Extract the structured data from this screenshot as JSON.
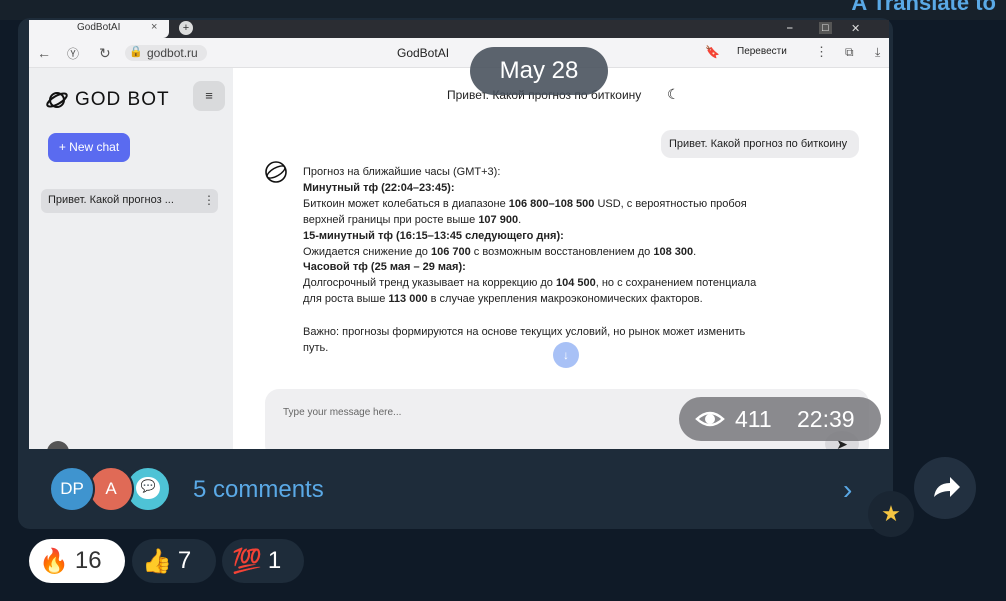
{
  "top": {
    "translate_label": "A Translate to"
  },
  "browser": {
    "tab_title": "GodBotAI",
    "tab_close": "×",
    "tab_plus": "+",
    "url": "godbot.ru",
    "page_title": "GodBotAI",
    "translate_label": "Перевести",
    "window_controls": [
      "⎯",
      "□",
      "✕"
    ]
  },
  "app": {
    "logo_text": "GOD BOT",
    "menu_icon": "≡",
    "new_chat_label": "+ New chat",
    "history": [
      {
        "label": "Привет. Какой прогноз ..."
      }
    ],
    "chat_title": "Привет. Какой прогноз по биткоину",
    "user_message": "Привет. Какой прогноз по биткоину",
    "bot_message": {
      "line1": "Прогноз на ближайшие часы (GMT+3):",
      "h1": "Минутный тф (22:04–23:45):",
      "p1a": "Биткоин может колебаться в диапазоне ",
      "p1b": "106 800–108 500",
      "p1c": " USD, с вероятностью пробоя",
      "p1d": "верхней границы при росте выше ",
      "p1e": "107 900",
      "p1f": ".",
      "h2": "15-минутный тф (16:15–13:45 следующего дня):",
      "p2a": "Ожидается снижение до ",
      "p2b": "106 700",
      "p2c": " с возможным восстановлением до ",
      "p2d": "108 300",
      "p2e": ".",
      "h3": "Часовой тф (25 мая – 29 мая):",
      "p3a": "Долгосрочный тренд указывает на коррекцию до ",
      "p3b": "104 500",
      "p3c": ", но с сохранением потенциала",
      "p3d": "для роста выше ",
      "p3e": "113 000",
      "p3f": " в случае укрепления макроэкономических факторов.",
      "p4a": "Важно: прогнозы формируются на основе текущих условий, но рынок может изменить",
      "p4b": "путь."
    },
    "input_placeholder": "Type your message here..."
  },
  "post": {
    "date": "May 28",
    "views": "411",
    "time": "22:39",
    "comments_label": "5 comments",
    "commenters": [
      "DP",
      "A"
    ]
  },
  "reactions": [
    {
      "emoji": "🔥",
      "count": "16"
    },
    {
      "emoji": "👍",
      "count": "7"
    },
    {
      "emoji": "💯",
      "count": "1"
    }
  ],
  "icons": {
    "star": "★",
    "chevron": "›",
    "scroll_down": "↓",
    "send": "➤",
    "moon": "☾",
    "bubble": "💬"
  }
}
